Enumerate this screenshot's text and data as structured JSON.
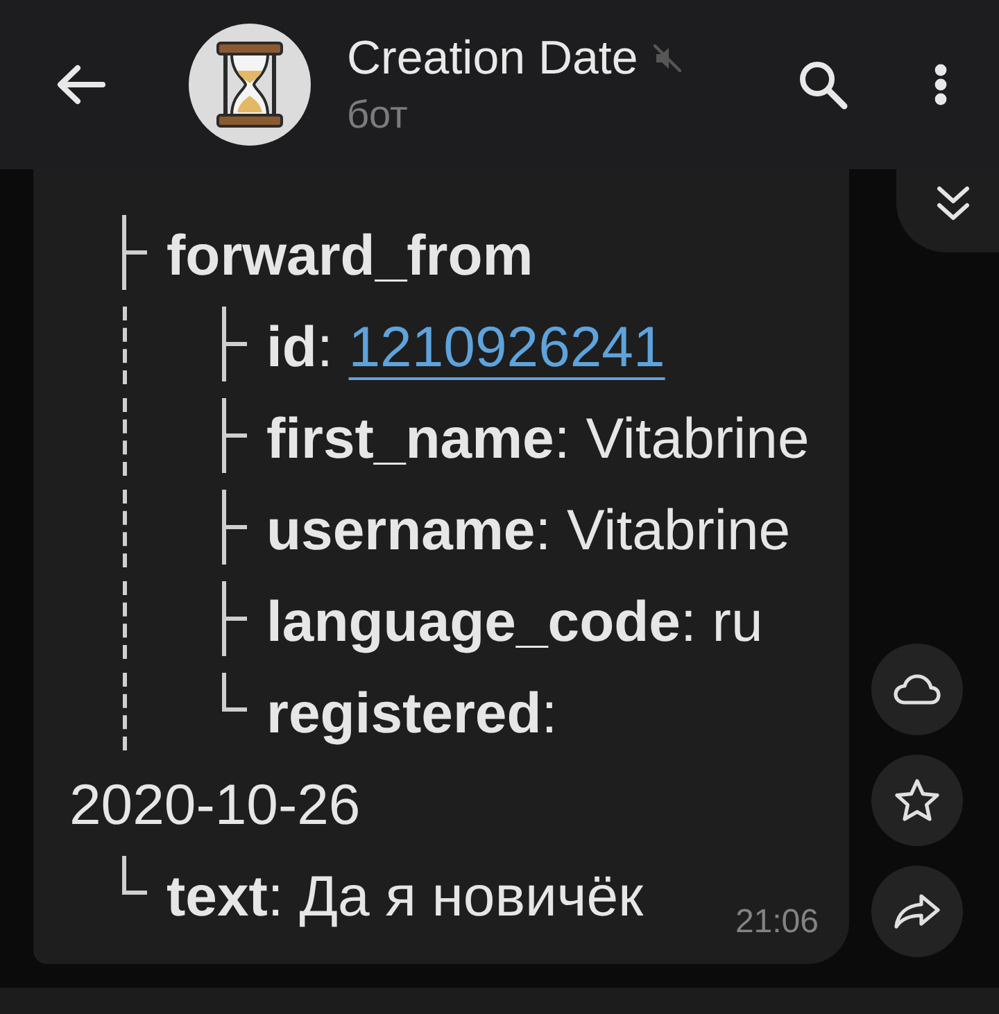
{
  "header": {
    "title": "Creation Date",
    "muted": true,
    "subtitle": "бот"
  },
  "message": {
    "fields": [
      {
        "kind": "object",
        "label": "forward_from",
        "children": [
          {
            "kind": "link",
            "label": "**id**:",
            "value": "1210926241"
          },
          {
            "kind": "text",
            "label": "**first_name**:",
            "value": "Vitabrine"
          },
          {
            "kind": "text",
            "label": "**username**:",
            "value": "Vitabrine"
          },
          {
            "kind": "text",
            "label": "**language_code**:",
            "value": "ru"
          },
          {
            "kind": "text",
            "label": "**registered**:",
            "value": "2020-10-26"
          }
        ]
      },
      {
        "kind": "text",
        "label": "**text**:",
        "value": "Да я новичёк"
      }
    ],
    "time": "21:06"
  }
}
